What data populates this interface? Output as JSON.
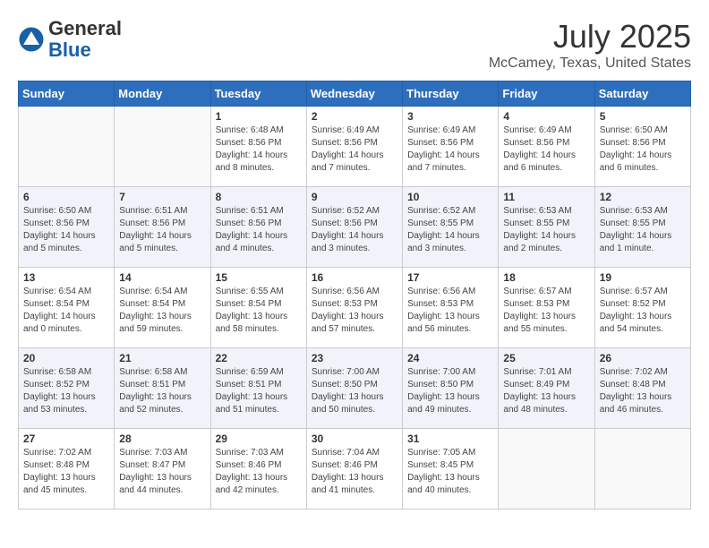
{
  "header": {
    "logo_general": "General",
    "logo_blue": "Blue",
    "month_title": "July 2025",
    "location": "McCamey, Texas, United States"
  },
  "days_of_week": [
    "Sunday",
    "Monday",
    "Tuesday",
    "Wednesday",
    "Thursday",
    "Friday",
    "Saturday"
  ],
  "weeks": [
    [
      {
        "day": "",
        "info": ""
      },
      {
        "day": "",
        "info": ""
      },
      {
        "day": "1",
        "info": "Sunrise: 6:48 AM\nSunset: 8:56 PM\nDaylight: 14 hours and 8 minutes."
      },
      {
        "day": "2",
        "info": "Sunrise: 6:49 AM\nSunset: 8:56 PM\nDaylight: 14 hours and 7 minutes."
      },
      {
        "day": "3",
        "info": "Sunrise: 6:49 AM\nSunset: 8:56 PM\nDaylight: 14 hours and 7 minutes."
      },
      {
        "day": "4",
        "info": "Sunrise: 6:49 AM\nSunset: 8:56 PM\nDaylight: 14 hours and 6 minutes."
      },
      {
        "day": "5",
        "info": "Sunrise: 6:50 AM\nSunset: 8:56 PM\nDaylight: 14 hours and 6 minutes."
      }
    ],
    [
      {
        "day": "6",
        "info": "Sunrise: 6:50 AM\nSunset: 8:56 PM\nDaylight: 14 hours and 5 minutes."
      },
      {
        "day": "7",
        "info": "Sunrise: 6:51 AM\nSunset: 8:56 PM\nDaylight: 14 hours and 5 minutes."
      },
      {
        "day": "8",
        "info": "Sunrise: 6:51 AM\nSunset: 8:56 PM\nDaylight: 14 hours and 4 minutes."
      },
      {
        "day": "9",
        "info": "Sunrise: 6:52 AM\nSunset: 8:56 PM\nDaylight: 14 hours and 3 minutes."
      },
      {
        "day": "10",
        "info": "Sunrise: 6:52 AM\nSunset: 8:55 PM\nDaylight: 14 hours and 3 minutes."
      },
      {
        "day": "11",
        "info": "Sunrise: 6:53 AM\nSunset: 8:55 PM\nDaylight: 14 hours and 2 minutes."
      },
      {
        "day": "12",
        "info": "Sunrise: 6:53 AM\nSunset: 8:55 PM\nDaylight: 14 hours and 1 minute."
      }
    ],
    [
      {
        "day": "13",
        "info": "Sunrise: 6:54 AM\nSunset: 8:54 PM\nDaylight: 14 hours and 0 minutes."
      },
      {
        "day": "14",
        "info": "Sunrise: 6:54 AM\nSunset: 8:54 PM\nDaylight: 13 hours and 59 minutes."
      },
      {
        "day": "15",
        "info": "Sunrise: 6:55 AM\nSunset: 8:54 PM\nDaylight: 13 hours and 58 minutes."
      },
      {
        "day": "16",
        "info": "Sunrise: 6:56 AM\nSunset: 8:53 PM\nDaylight: 13 hours and 57 minutes."
      },
      {
        "day": "17",
        "info": "Sunrise: 6:56 AM\nSunset: 8:53 PM\nDaylight: 13 hours and 56 minutes."
      },
      {
        "day": "18",
        "info": "Sunrise: 6:57 AM\nSunset: 8:53 PM\nDaylight: 13 hours and 55 minutes."
      },
      {
        "day": "19",
        "info": "Sunrise: 6:57 AM\nSunset: 8:52 PM\nDaylight: 13 hours and 54 minutes."
      }
    ],
    [
      {
        "day": "20",
        "info": "Sunrise: 6:58 AM\nSunset: 8:52 PM\nDaylight: 13 hours and 53 minutes."
      },
      {
        "day": "21",
        "info": "Sunrise: 6:58 AM\nSunset: 8:51 PM\nDaylight: 13 hours and 52 minutes."
      },
      {
        "day": "22",
        "info": "Sunrise: 6:59 AM\nSunset: 8:51 PM\nDaylight: 13 hours and 51 minutes."
      },
      {
        "day": "23",
        "info": "Sunrise: 7:00 AM\nSunset: 8:50 PM\nDaylight: 13 hours and 50 minutes."
      },
      {
        "day": "24",
        "info": "Sunrise: 7:00 AM\nSunset: 8:50 PM\nDaylight: 13 hours and 49 minutes."
      },
      {
        "day": "25",
        "info": "Sunrise: 7:01 AM\nSunset: 8:49 PM\nDaylight: 13 hours and 48 minutes."
      },
      {
        "day": "26",
        "info": "Sunrise: 7:02 AM\nSunset: 8:48 PM\nDaylight: 13 hours and 46 minutes."
      }
    ],
    [
      {
        "day": "27",
        "info": "Sunrise: 7:02 AM\nSunset: 8:48 PM\nDaylight: 13 hours and 45 minutes."
      },
      {
        "day": "28",
        "info": "Sunrise: 7:03 AM\nSunset: 8:47 PM\nDaylight: 13 hours and 44 minutes."
      },
      {
        "day": "29",
        "info": "Sunrise: 7:03 AM\nSunset: 8:46 PM\nDaylight: 13 hours and 42 minutes."
      },
      {
        "day": "30",
        "info": "Sunrise: 7:04 AM\nSunset: 8:46 PM\nDaylight: 13 hours and 41 minutes."
      },
      {
        "day": "31",
        "info": "Sunrise: 7:05 AM\nSunset: 8:45 PM\nDaylight: 13 hours and 40 minutes."
      },
      {
        "day": "",
        "info": ""
      },
      {
        "day": "",
        "info": ""
      }
    ]
  ]
}
